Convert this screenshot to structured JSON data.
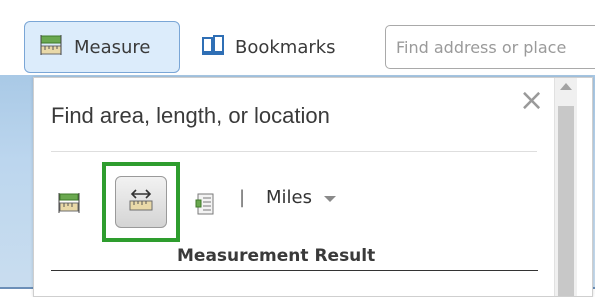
{
  "toolbar": {
    "measure_label": "Measure",
    "bookmarks_label": "Bookmarks",
    "search_placeholder": "Find address or place"
  },
  "panel": {
    "title": "Find area, length, or location",
    "unit_separator": "|",
    "unit_selected": "Miles",
    "result_header": "Measurement Result"
  },
  "colors": {
    "active_button_bg": "#dcecfb",
    "active_button_border": "#7aa6d6",
    "highlight_green": "#2e9d2e",
    "tool_icon_green": "#5a9e3a"
  },
  "icons": {
    "measure": "ruler-area-icon",
    "bookmarks": "bookmark-icon",
    "close": "close-icon",
    "area_tool": "area-measure-icon",
    "distance_tool": "distance-measure-icon",
    "location_tool": "location-measure-icon",
    "unit_dropdown": "chevron-down-icon"
  }
}
